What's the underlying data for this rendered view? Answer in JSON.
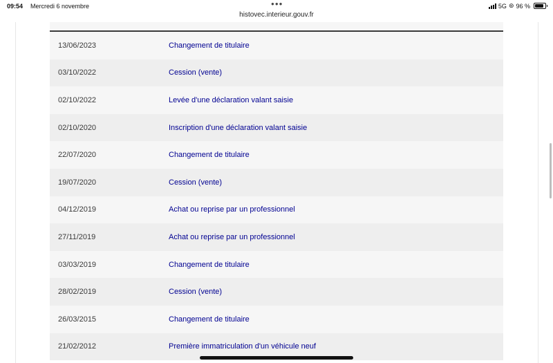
{
  "status_bar": {
    "time": "09:54",
    "date": "Mercredi 6 novembre",
    "network": "5G",
    "battery": "96 %",
    "url": "histovec.interieur.gouv.fr"
  },
  "history": [
    {
      "date": "13/06/2023",
      "operation": "Changement de titulaire"
    },
    {
      "date": "03/10/2022",
      "operation": "Cession (vente)"
    },
    {
      "date": "02/10/2022",
      "operation": "Levée d'une déclaration valant saisie"
    },
    {
      "date": "02/10/2020",
      "operation": "Inscription d'une déclaration valant saisie"
    },
    {
      "date": "22/07/2020",
      "operation": "Changement de titulaire"
    },
    {
      "date": "19/07/2020",
      "operation": "Cession (vente)"
    },
    {
      "date": "04/12/2019",
      "operation": "Achat ou reprise par un professionnel"
    },
    {
      "date": "27/11/2019",
      "operation": "Achat ou reprise par un professionnel"
    },
    {
      "date": "03/03/2019",
      "operation": "Changement de titulaire"
    },
    {
      "date": "28/02/2019",
      "operation": "Cession (vente)"
    },
    {
      "date": "26/03/2015",
      "operation": "Changement de titulaire"
    },
    {
      "date": "21/02/2012",
      "operation": "Première immatriculation d'un véhicule neuf"
    }
  ]
}
